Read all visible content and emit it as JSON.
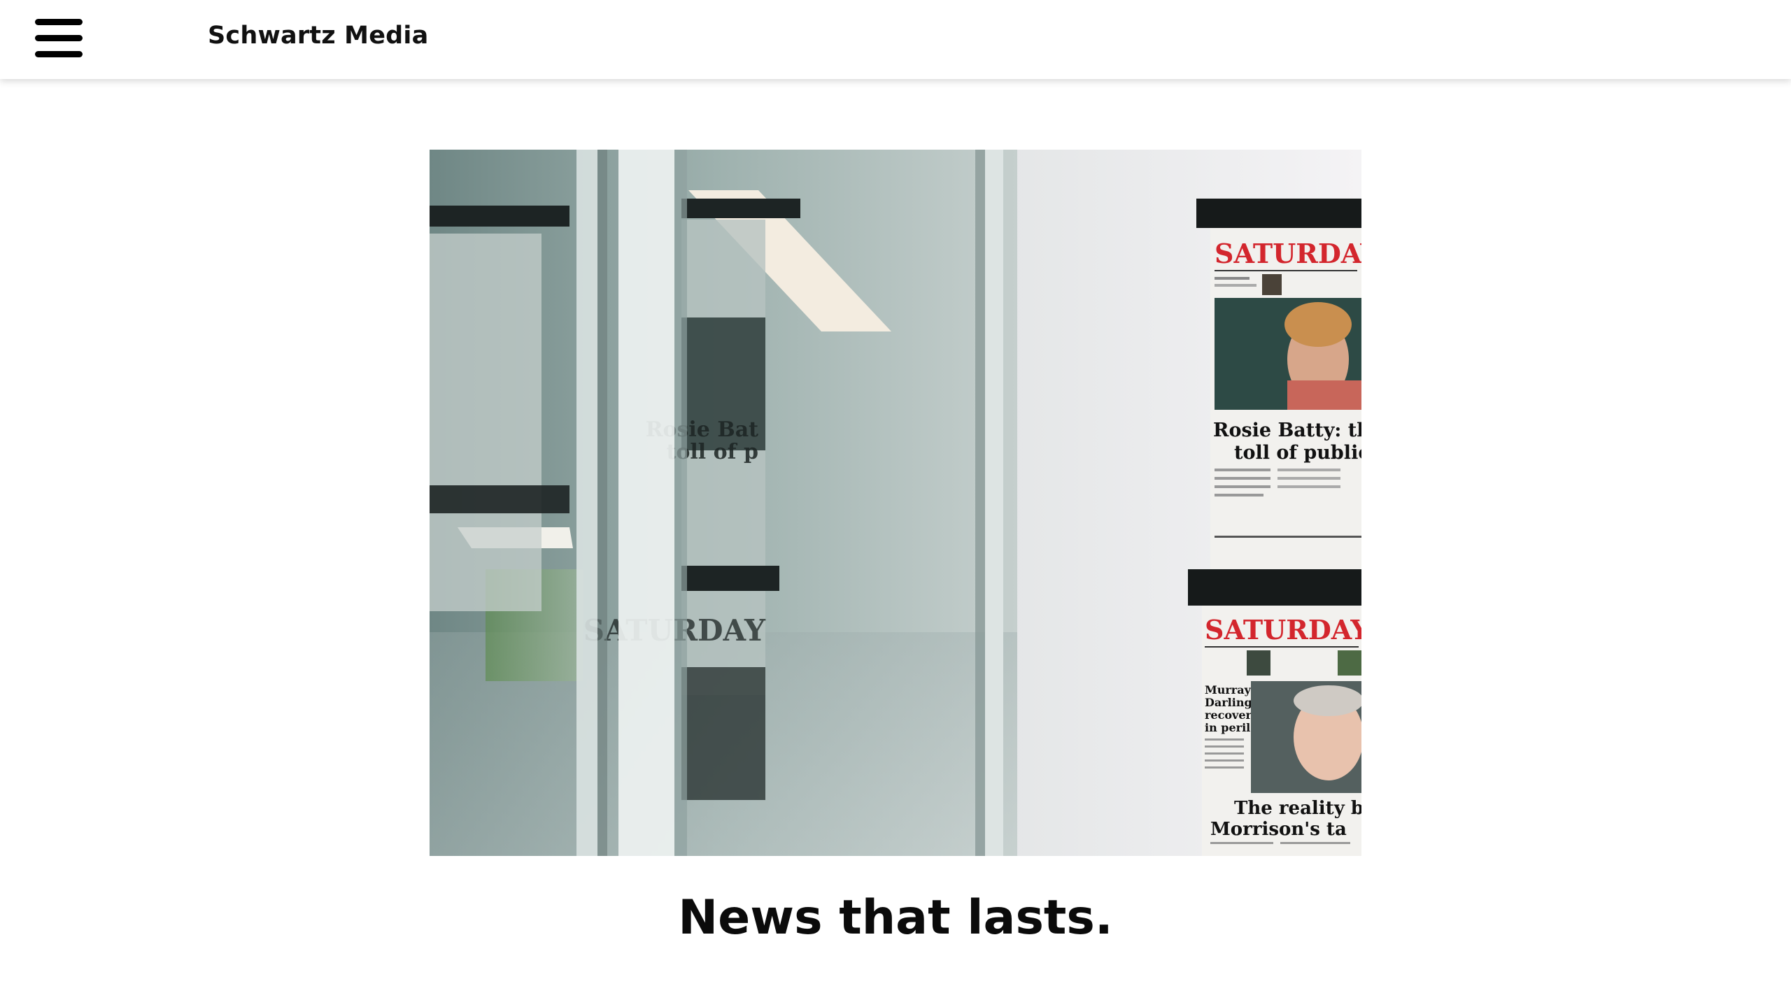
{
  "header": {
    "menu_icon": "hamburger-menu-icon",
    "brand_name": "Schwartz Media"
  },
  "hero": {
    "image_subject": "newsroom-newspapers-photo",
    "newspapers": {
      "top_right": {
        "masthead": "SATURDAY",
        "headline_line1": "Rosie Batty: the p",
        "headline_line2": "toll of public g"
      },
      "bottom_right": {
        "masthead": "SATURDAY",
        "side_story": [
          "Murray-",
          "Darling",
          "recovery",
          "in peril"
        ],
        "headline_line1": "The reality b",
        "headline_line2": "Morrison's ta"
      },
      "reflection_left": {
        "masthead": "SATURDAY",
        "headline_line1": "Rosie Bat",
        "headline_line2": "toll of p"
      }
    }
  },
  "main": {
    "tagline": "News that lasts."
  },
  "colors": {
    "masthead_red": "#d3262d",
    "header_bg": "#ffffff",
    "text": "#0b0b0b"
  }
}
